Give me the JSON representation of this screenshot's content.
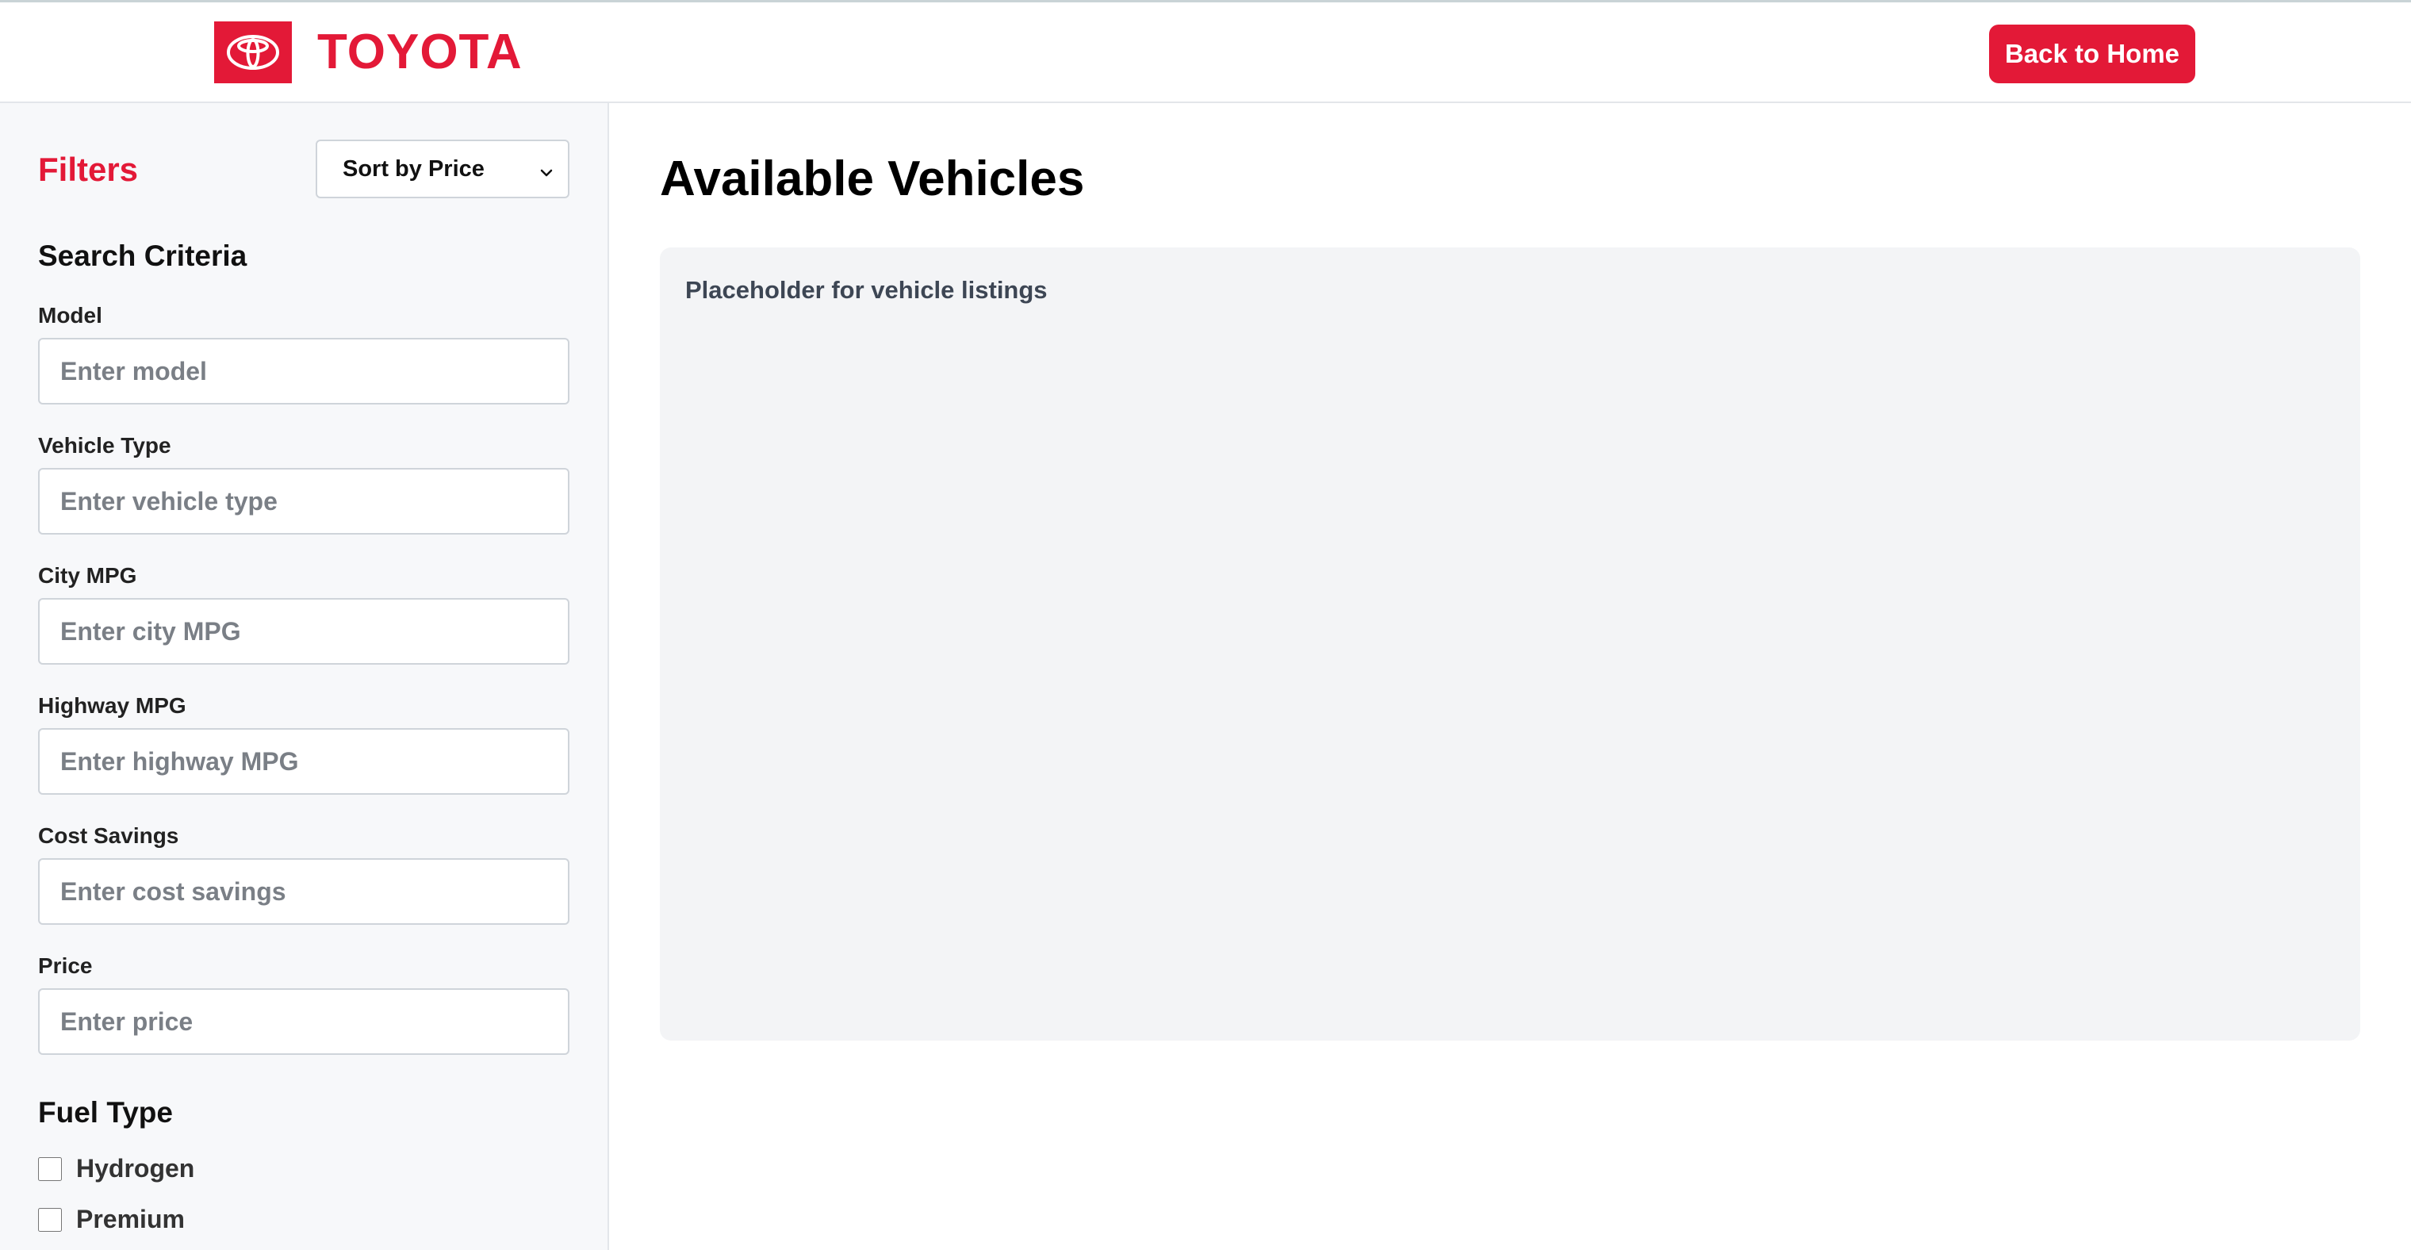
{
  "header": {
    "brand_name": "TOYOTA",
    "logo_icon": "toyota-emblem-icon",
    "back_button_label": "Back to Home",
    "brand_color": "#e31937"
  },
  "sidebar": {
    "title": "Filters",
    "sort": {
      "selected": "Sort by Price",
      "icon": "chevron-down-icon"
    },
    "search_criteria_title": "Search Criteria",
    "fields": [
      {
        "label": "Model",
        "placeholder": "Enter model",
        "value": ""
      },
      {
        "label": "Vehicle Type",
        "placeholder": "Enter vehicle type",
        "value": ""
      },
      {
        "label": "City MPG",
        "placeholder": "Enter city MPG",
        "value": ""
      },
      {
        "label": "Highway MPG",
        "placeholder": "Enter highway MPG",
        "value": ""
      },
      {
        "label": "Cost Savings",
        "placeholder": "Enter cost savings",
        "value": ""
      },
      {
        "label": "Price",
        "placeholder": "Enter price",
        "value": ""
      }
    ],
    "fuel_type_title": "Fuel Type",
    "fuel_types": [
      {
        "label": "Hydrogen",
        "checked": false
      },
      {
        "label": "Premium",
        "checked": false
      }
    ]
  },
  "main": {
    "title": "Available Vehicles",
    "listings_placeholder": "Placeholder for vehicle listings"
  }
}
